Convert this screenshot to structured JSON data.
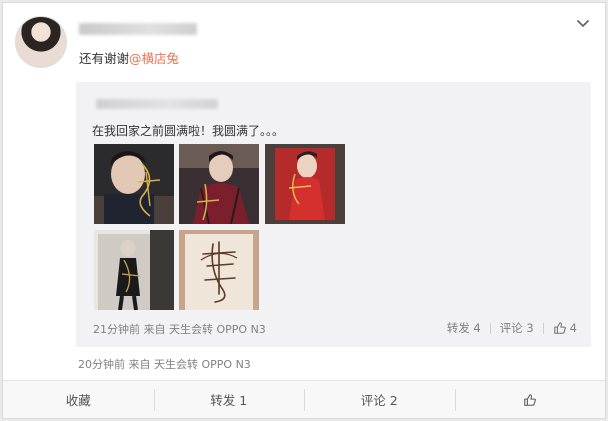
{
  "post": {
    "text": "还有谢谢",
    "mention": "@横店兔",
    "meta": "20分钟前 来自 天生会转 OPPO N3"
  },
  "repost": {
    "text": "在我回家之前圆满啦！我圆满了。。。",
    "meta": "21分钟前 来自 天生会转 OPPO N3",
    "forward_label": "转发 4",
    "comment_label": "评论 3",
    "like_count": "4"
  },
  "actions": {
    "favorite": "收藏",
    "forward": "转发 1",
    "comment": "评论 2"
  },
  "icons": {
    "chevron": "chevron-down-icon",
    "like": "thumbs-up-icon"
  },
  "colors": {
    "mention": "#eb7350",
    "meta_text": "#808080",
    "repost_bg": "#f2f2f5"
  }
}
